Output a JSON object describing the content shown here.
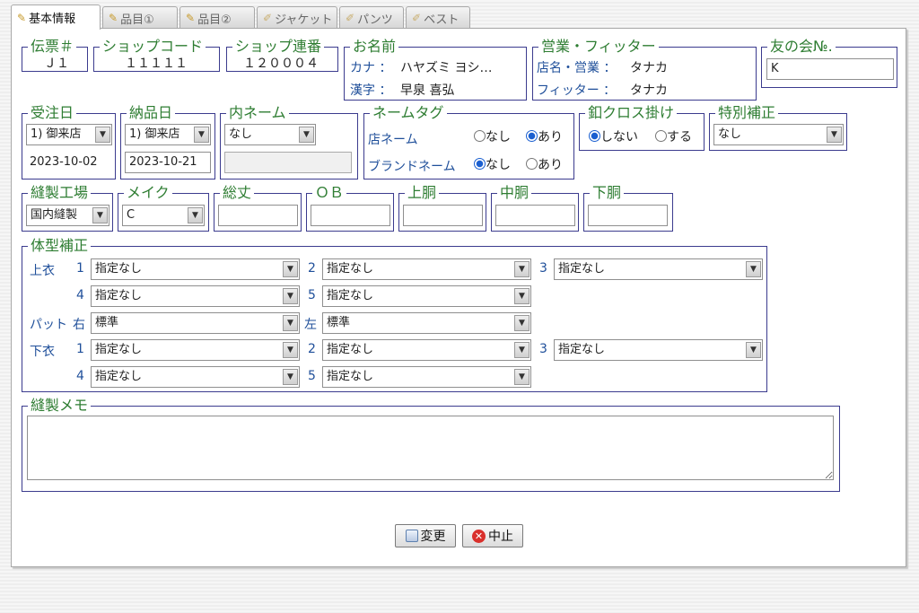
{
  "tabs": [
    {
      "label": "基本情報",
      "icon": "edit-icon"
    },
    {
      "label": "品目①",
      "icon": "edit-icon"
    },
    {
      "label": "品目②",
      "icon": "edit-icon"
    },
    {
      "label": "ジャケット",
      "icon": "pencil-icon"
    },
    {
      "label": "パンツ",
      "icon": "pencil-icon"
    },
    {
      "label": "ベスト",
      "icon": "pencil-icon"
    }
  ],
  "header": {
    "denpyo": {
      "legend": "伝票＃",
      "value": "Ｊ１"
    },
    "shop_code": {
      "legend": "ショップコード",
      "value": "１１１１１"
    },
    "shop_seq": {
      "legend": "ショップ連番",
      "value": "１２０００４"
    },
    "name": {
      "legend": "お名前",
      "kana_label": "カナ ：",
      "kana_value": "ハヤズミ ヨシ…",
      "kanji_label": "漢字 ：",
      "kanji_value": "早泉 喜弘"
    },
    "sales": {
      "legend": "営業・フィッター",
      "store_label": "店名・営業 ：",
      "store_value": "タナカ",
      "fitter_label": "フィッター ：",
      "fitter_value": "タナカ"
    },
    "tomo": {
      "legend": "友の会№.",
      "value": "K"
    }
  },
  "row2": {
    "order_date": {
      "legend": "受注日",
      "select": "1) 御来店",
      "date": "2023-10-02"
    },
    "delivery_date": {
      "legend": "納品日",
      "select": "1) 御来店",
      "date": "2023-10-21"
    },
    "inner_name": {
      "legend": "内ネーム",
      "select": "なし",
      "text": ""
    },
    "name_tag": {
      "legend": "ネームタグ",
      "store_label": "店ネーム",
      "brand_label": "ブランドネーム",
      "opt_none": "なし",
      "opt_yes": "あり",
      "store_selected": "あり",
      "brand_selected": "なし"
    },
    "hook_cross": {
      "legend": "釦クロス掛け",
      "opt_no": "しない",
      "opt_yes": "する",
      "selected": "しない"
    },
    "special": {
      "legend": "特別補正",
      "select": "なし"
    }
  },
  "row3": {
    "factory": {
      "legend": "縫製工場",
      "select": "国内縫製"
    },
    "make": {
      "legend": "メイク",
      "select": "C"
    },
    "total_length": {
      "legend": "総丈",
      "value": ""
    },
    "ob": {
      "legend": "ＯＢ",
      "value": ""
    },
    "upper_torso": {
      "legend": "上胴",
      "value": ""
    },
    "mid_torso": {
      "legend": "中胴",
      "value": ""
    },
    "lower_torso": {
      "legend": "下胴",
      "value": ""
    }
  },
  "body_correction": {
    "legend": "体型補正",
    "jacket_label": "上衣",
    "pad_label": "パット",
    "pants_label": "下衣",
    "right_label": "右",
    "left_label": "左",
    "n1": "1",
    "n2": "2",
    "n3": "3",
    "n4": "4",
    "n5": "5",
    "jacket": [
      "指定なし",
      "指定なし",
      "指定なし",
      "指定なし",
      "指定なし"
    ],
    "pad_right": "標準",
    "pad_left": "標準",
    "pants": [
      "指定なし",
      "指定なし",
      "指定なし",
      "指定なし",
      "指定なし"
    ]
  },
  "memo": {
    "legend": "縫製メモ",
    "value": ""
  },
  "buttons": {
    "change": "変更",
    "cancel": "中止"
  }
}
